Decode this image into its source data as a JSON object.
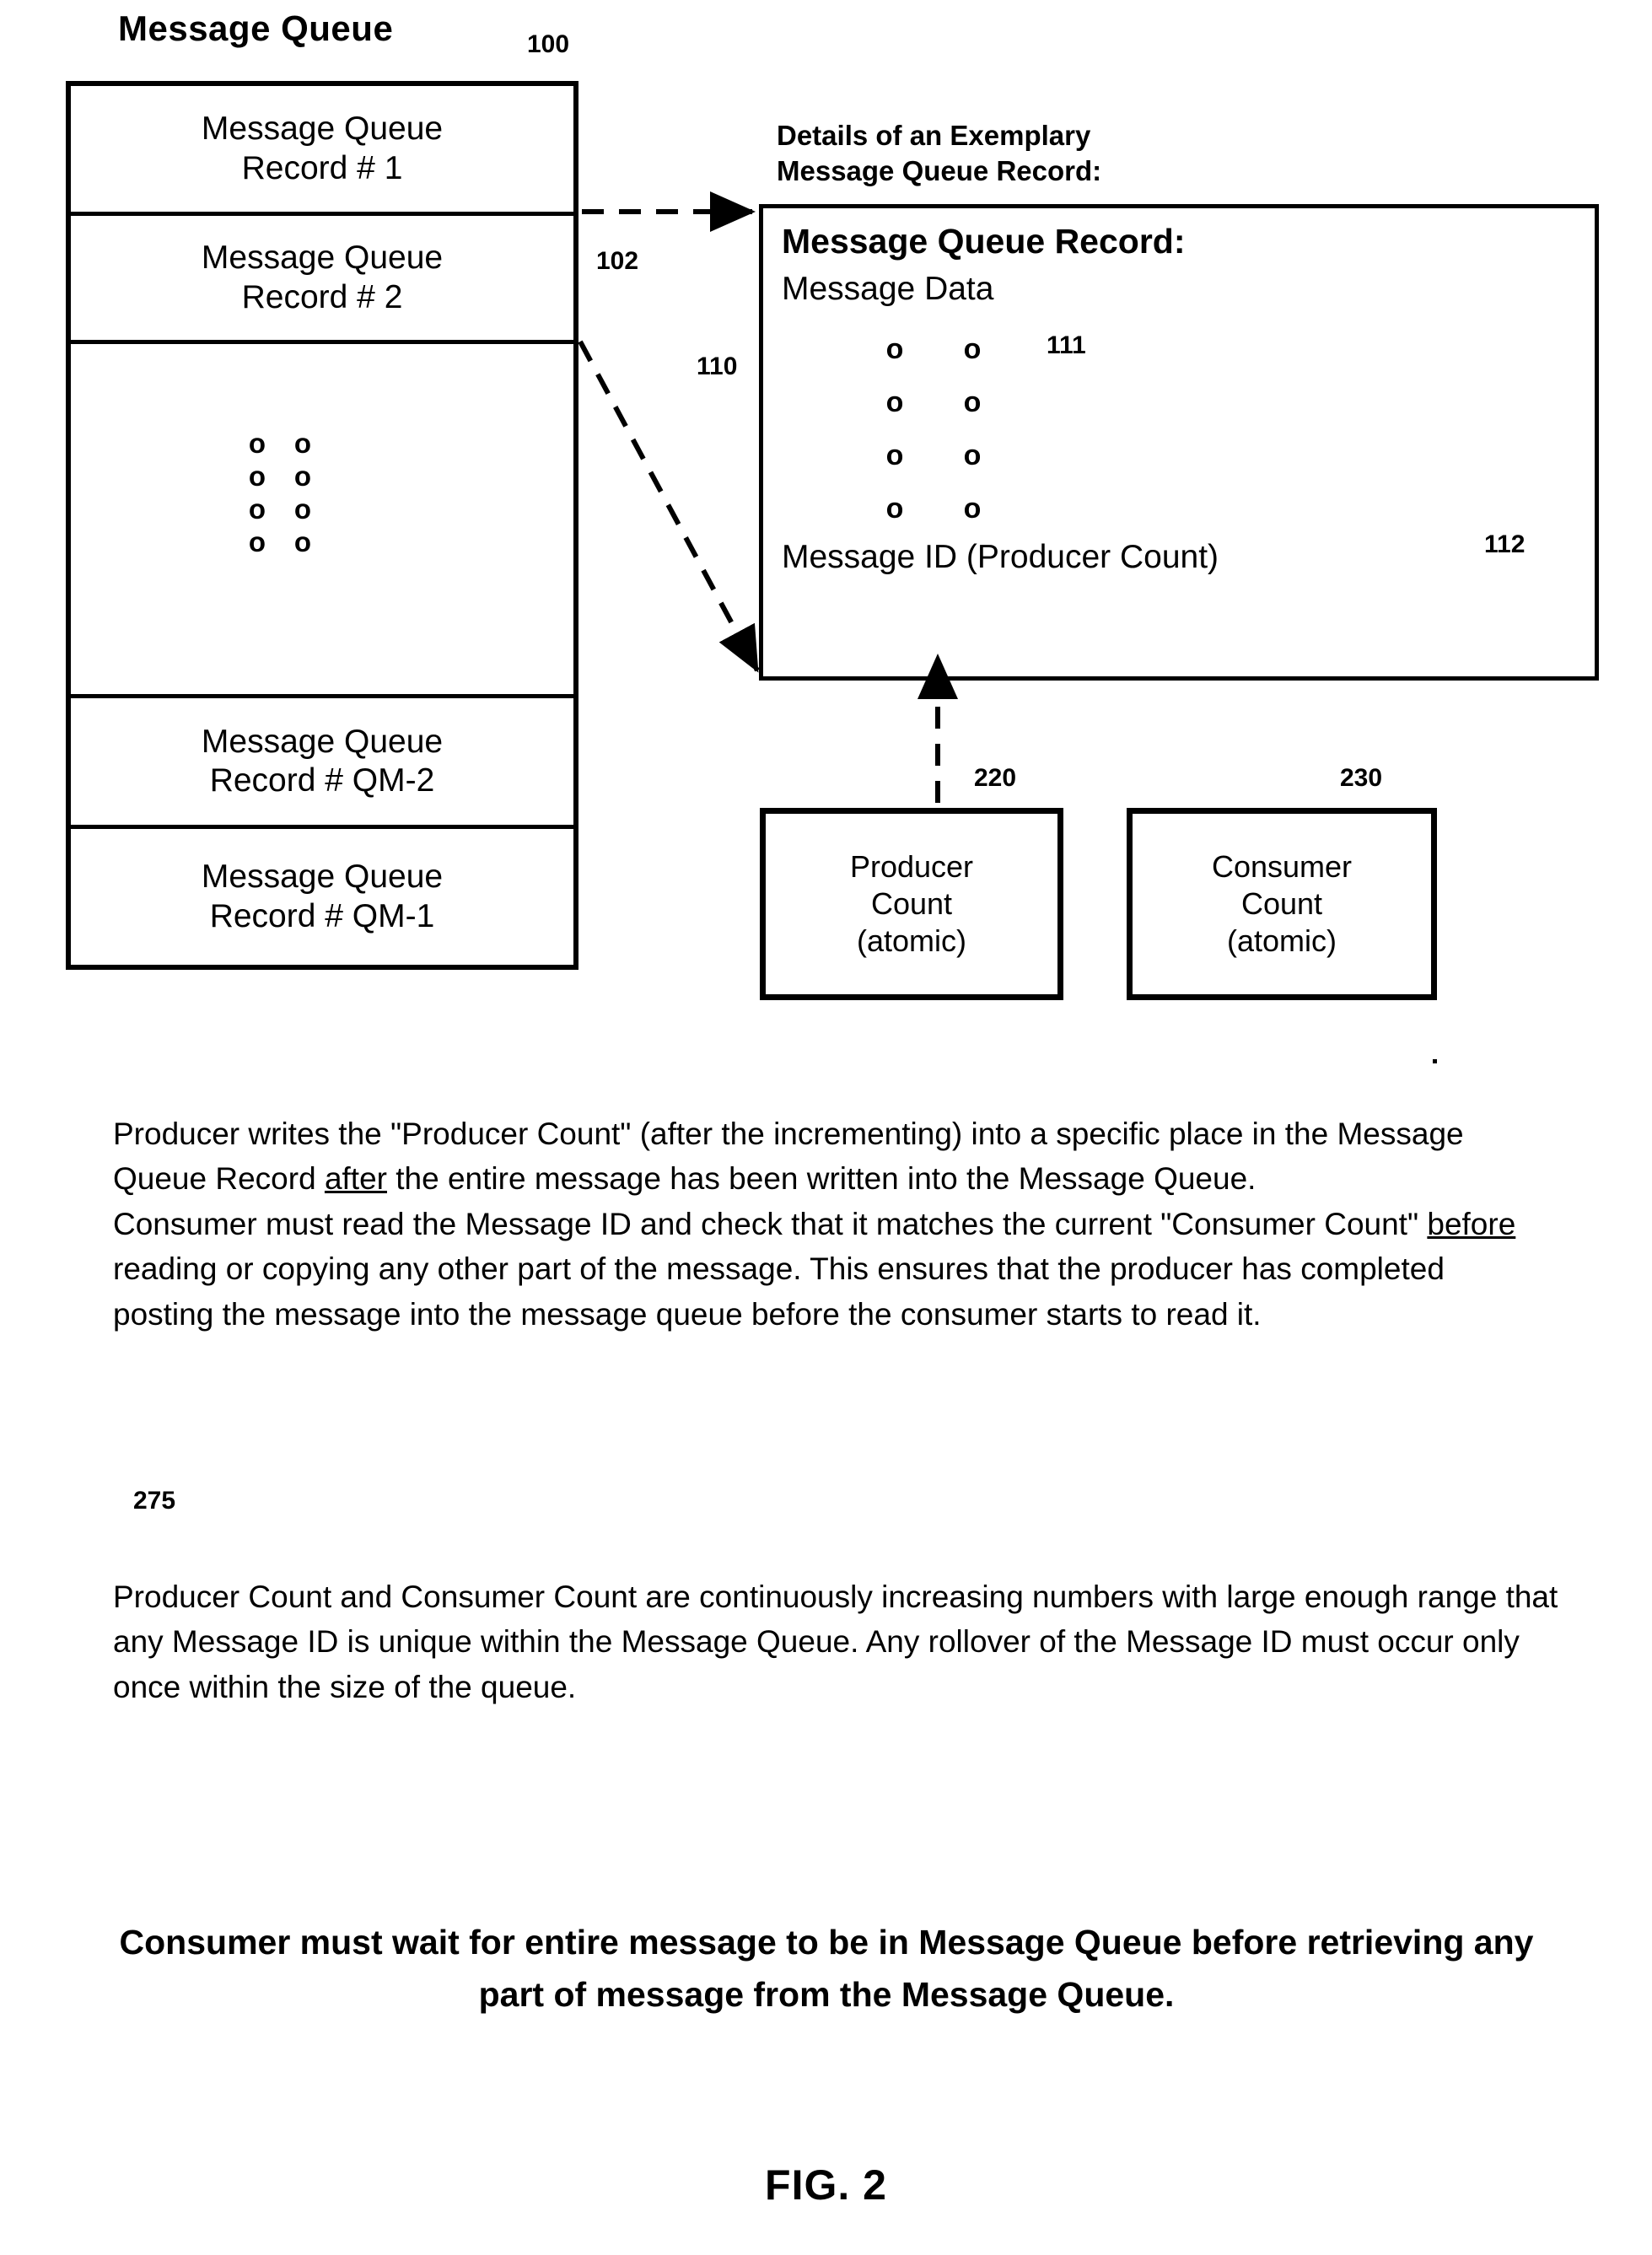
{
  "figure": {
    "caption": "FIG. 2",
    "queue": {
      "title": "Message Queue",
      "ref": "100",
      "records": [
        {
          "line1": "Message Queue",
          "line2": "Record # 1"
        },
        {
          "line1": "Message Queue",
          "line2": "Record # 2"
        },
        {
          "line1": "Message Queue",
          "line2": "Record # QM-2"
        },
        {
          "line1": "Message Queue",
          "line2": "Record # QM-1"
        }
      ],
      "ellipsis_glyph": "o",
      "ellipsis_rows": 4,
      "ellipsis_cols": 2
    },
    "details_label": {
      "line1": "Details of an Exemplary",
      "line2": "Message Queue Record:"
    },
    "record": {
      "title": "Message Queue Record:",
      "subtitle": "Message Data",
      "message_id": "Message ID (Producer Count)",
      "ref_box": "110",
      "ref_data": "111",
      "ref_msgid": "112",
      "ref_pointer": "102",
      "ellipsis_glyph": "o",
      "ellipsis_rows": 4,
      "ellipsis_cols": 2
    },
    "producer_count": {
      "line1": "Producer",
      "line2": "Count",
      "line3": "(atomic)",
      "ref": "220"
    },
    "consumer_count": {
      "line1": "Consumer",
      "line2": "Count",
      "line3": "(atomic)",
      "ref": "230"
    }
  },
  "text": {
    "para1_a": "Producer writes the \"Producer Count\" (after the incrementing) into a specific place in the Message Queue Record ",
    "para1_underline": "after",
    "para1_b": " the entire message has been written into the Message Queue.",
    "para2_a": "Consumer must read the Message ID and check that it matches the current \"Consumer Count\" ",
    "para2_underline": "before",
    "para2_b": " reading or copying any other part of the message. This ensures that the producer has completed posting the message into the message queue before the consumer starts to read it.",
    "ref_275": "275",
    "para3": "Producer Count and Consumer Count are continuously increasing numbers with large enough range that any Message ID is unique within the Message Queue.  Any rollover of the Message ID must occur only once within the size of the queue.",
    "conclusion": "Consumer must wait for entire message to be in Message Queue before retrieving any part of message from the Message Queue."
  },
  "colors": {
    "ink": "#000000",
    "paper": "#ffffff"
  }
}
